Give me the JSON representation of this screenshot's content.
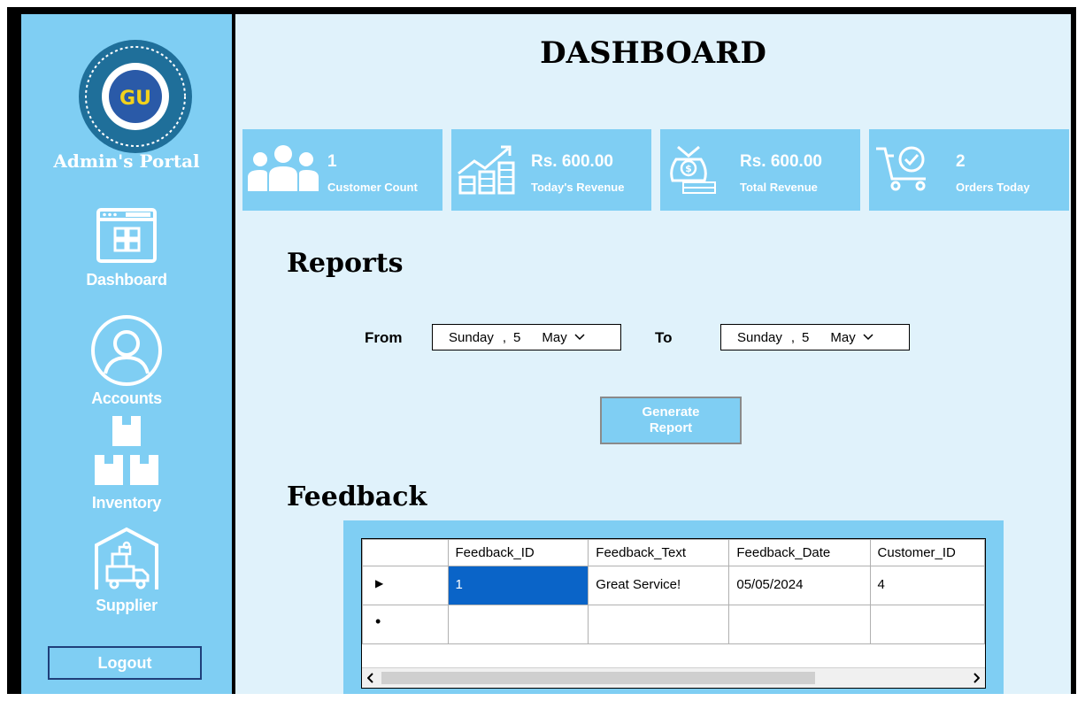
{
  "sidebar": {
    "portal_title": "Admin's Portal",
    "items": [
      {
        "label": "Dashboard",
        "icon": "dashboard-icon"
      },
      {
        "label": "Accounts",
        "icon": "user-circle-icon"
      },
      {
        "label": "Inventory",
        "icon": "boxes-icon"
      },
      {
        "label": "Supplier",
        "icon": "warehouse-truck-icon"
      }
    ],
    "logout_label": "Logout"
  },
  "header": {
    "title": "DASHBOARD"
  },
  "cards": [
    {
      "value": "1",
      "caption": "Customer Count",
      "icon": "people-icon"
    },
    {
      "value": "Rs. 600.00",
      "caption": "Today's Revenue",
      "icon": "coins-growth-icon"
    },
    {
      "value": "Rs. 600.00",
      "caption": "Total Revenue",
      "icon": "money-bag-icon"
    },
    {
      "value": "2",
      "caption": "Orders Today",
      "icon": "cart-check-icon"
    }
  ],
  "reports": {
    "title": "Reports",
    "from_label": "From",
    "to_label": "To",
    "from_date": {
      "day_name": "Sunday",
      "day": "5",
      "month": "May"
    },
    "to_date": {
      "day_name": "Sunday",
      "day": "5",
      "month": "May"
    },
    "generate_label_1": "Generate",
    "generate_label_2": "Report"
  },
  "feedback": {
    "title": "Feedback",
    "columns": [
      "Feedback_ID",
      "Feedback_Text",
      "Feedback_Date",
      "Customer_ID"
    ],
    "rows": [
      {
        "marker": "▶",
        "cells": [
          "1",
          "Great Service!",
          "05/05/2024",
          "4"
        ]
      },
      {
        "marker": "•",
        "cells": [
          "",
          "",
          "",
          ""
        ]
      }
    ]
  },
  "colors": {
    "sidebar": "#7fcef3",
    "main_bg": "#e0f2fb",
    "selection": "#0a64c8"
  }
}
